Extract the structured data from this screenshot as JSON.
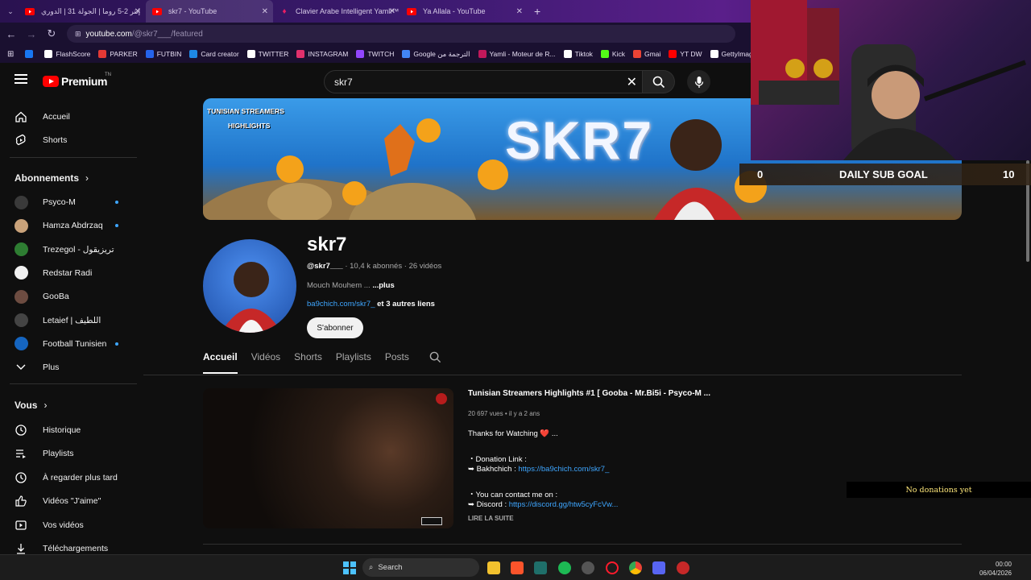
{
  "browser": {
    "tabs": [
      {
        "label": "إنتر 2-5 روما | الجولة 31 | الدوري",
        "active": false
      },
      {
        "label": "skr7 - YouTube",
        "active": true
      },
      {
        "label": "Clavier Arabe Intelligent Yamli™ -",
        "active": false
      },
      {
        "label": "Ya Allala - YouTube",
        "active": false
      }
    ],
    "new_tab": "+",
    "url_host": "youtube.com",
    "url_path": "/@skr7___/featured",
    "bookmarks": [
      {
        "label": "",
        "color": "#1877f2"
      },
      {
        "label": "FlashScore",
        "color": "#ffffff"
      },
      {
        "label": "PARKER",
        "color": "#e53935"
      },
      {
        "label": "FUTBIN",
        "color": "#2563eb"
      },
      {
        "label": "Card creator",
        "color": "#1e88e5"
      },
      {
        "label": "TWITTER",
        "color": "#ffffff"
      },
      {
        "label": "INSTAGRAM",
        "color": "#e1306c"
      },
      {
        "label": "TWITCH",
        "color": "#9146ff"
      },
      {
        "label": "Google الترجمة من",
        "color": "#4285f4"
      },
      {
        "label": "Yamli - Moteur de R...",
        "color": "#c2185b"
      },
      {
        "label": "Tiktok",
        "color": "#ffffff"
      },
      {
        "label": "Kick",
        "color": "#53fc18"
      },
      {
        "label": "Gmai",
        "color": "#ea4335"
      },
      {
        "label": "YT DW",
        "color": "#ff0000"
      },
      {
        "label": "GettyImages - HD",
        "color": "#ffffff"
      }
    ]
  },
  "youtube": {
    "brand": "Premium",
    "brand_sup": "TN",
    "search_value": "skr7",
    "sidebar": {
      "main": [
        {
          "label": "Accueil",
          "icon": "home-icon"
        },
        {
          "label": "Shorts",
          "icon": "shorts-icon"
        }
      ],
      "subs_header": "Abonnements",
      "subscriptions": [
        {
          "label": "Psyco-M",
          "color": "#3a3a3a",
          "new": true
        },
        {
          "label": "Hamza Abdrzaq",
          "color": "#c9a27a",
          "new": true
        },
        {
          "label": "Trezegol - تريزيقول",
          "color": "#2e7d32",
          "new": false
        },
        {
          "label": "Redstar Radi",
          "color": "#f1f1f1",
          "new": false
        },
        {
          "label": "GooBa",
          "color": "#6d4c41",
          "new": false
        },
        {
          "label": "Letaief | اللطيف",
          "color": "#444444",
          "new": false
        },
        {
          "label": "Football Tunisien",
          "color": "#1565c0",
          "new": true
        }
      ],
      "more": "Plus",
      "you_header": "Vous",
      "you": [
        {
          "label": "Historique",
          "icon": "history-icon"
        },
        {
          "label": "Playlists",
          "icon": "playlists-icon"
        },
        {
          "label": "À regarder plus tard",
          "icon": "watch-later-icon"
        },
        {
          "label": "Vidéos \"J'aime\"",
          "icon": "like-icon"
        },
        {
          "label": "Vos vidéos",
          "icon": "your-videos-icon"
        },
        {
          "label": "Téléchargements",
          "icon": "download-icon"
        }
      ]
    },
    "banner": {
      "line1": "TUNISIAN STREAMERS",
      "line2": "HIGHLIGHTS",
      "title": "SKR7"
    },
    "channel": {
      "name": "skr7",
      "handle": "@skr7___",
      "subs": "10,4 k abonnés",
      "videos": "26 vidéos",
      "desc": "Mouch Mouhem ...",
      "desc_more": "...plus",
      "link": "ba9chich.com/skr7_",
      "link_more": "et 3 autres liens",
      "subscribe": "S'abonner"
    },
    "tabs": [
      "Accueil",
      "Vidéos",
      "Shorts",
      "Playlists",
      "Posts"
    ],
    "video": {
      "title": "Tunisian Streamers Highlights #1 [ Gooba - Mr.Bi5i - Psyco-M ...",
      "views": "20 697 vues",
      "age": "il y a 2 ans",
      "desc": [
        {
          "text": "Thanks for Watching ❤️ ...",
          "link": ""
        },
        {
          "text": "",
          "link": ""
        },
        {
          "text": "・Donation Link :",
          "link": ""
        },
        {
          "text": "➥ Bakhchich : ",
          "link": "https://ba9chich.com/skr7_"
        },
        {
          "text": "",
          "link": ""
        },
        {
          "text": "・You can contact me on :",
          "link": ""
        },
        {
          "text": "➥ Discord : ",
          "link": "https://discord.gg/htw5cyFcVw..."
        }
      ],
      "more": "LIRE LA SUITE"
    }
  },
  "overlay": {
    "goal_left": "0",
    "goal_label": "DAILY SUB GOAL",
    "goal_right": "10",
    "donations": "No donations yet"
  },
  "taskbar": {
    "search": "Search",
    "time": "00:00",
    "date": "06/04/2026"
  }
}
